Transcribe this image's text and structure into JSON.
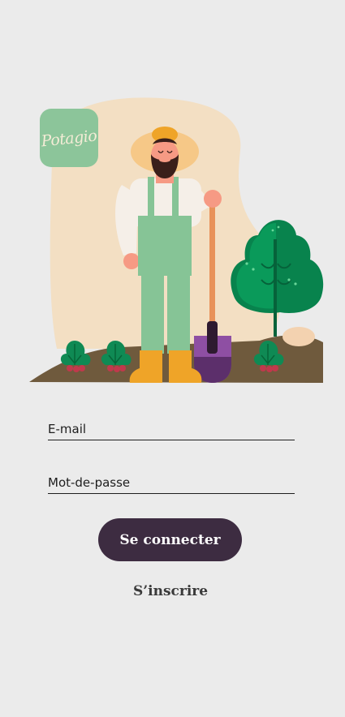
{
  "app": {
    "logo_text": "Potagio"
  },
  "form": {
    "email_label": "E-mail",
    "password_label": "Mot-de-passe",
    "login_button": "Se connecter",
    "signup_link": "S’inscrire"
  },
  "colors": {
    "background": "#ebebeb",
    "logo_green": "#8cc59a",
    "primary_button": "#3d2c41",
    "text_dark": "#1e1e1e"
  }
}
